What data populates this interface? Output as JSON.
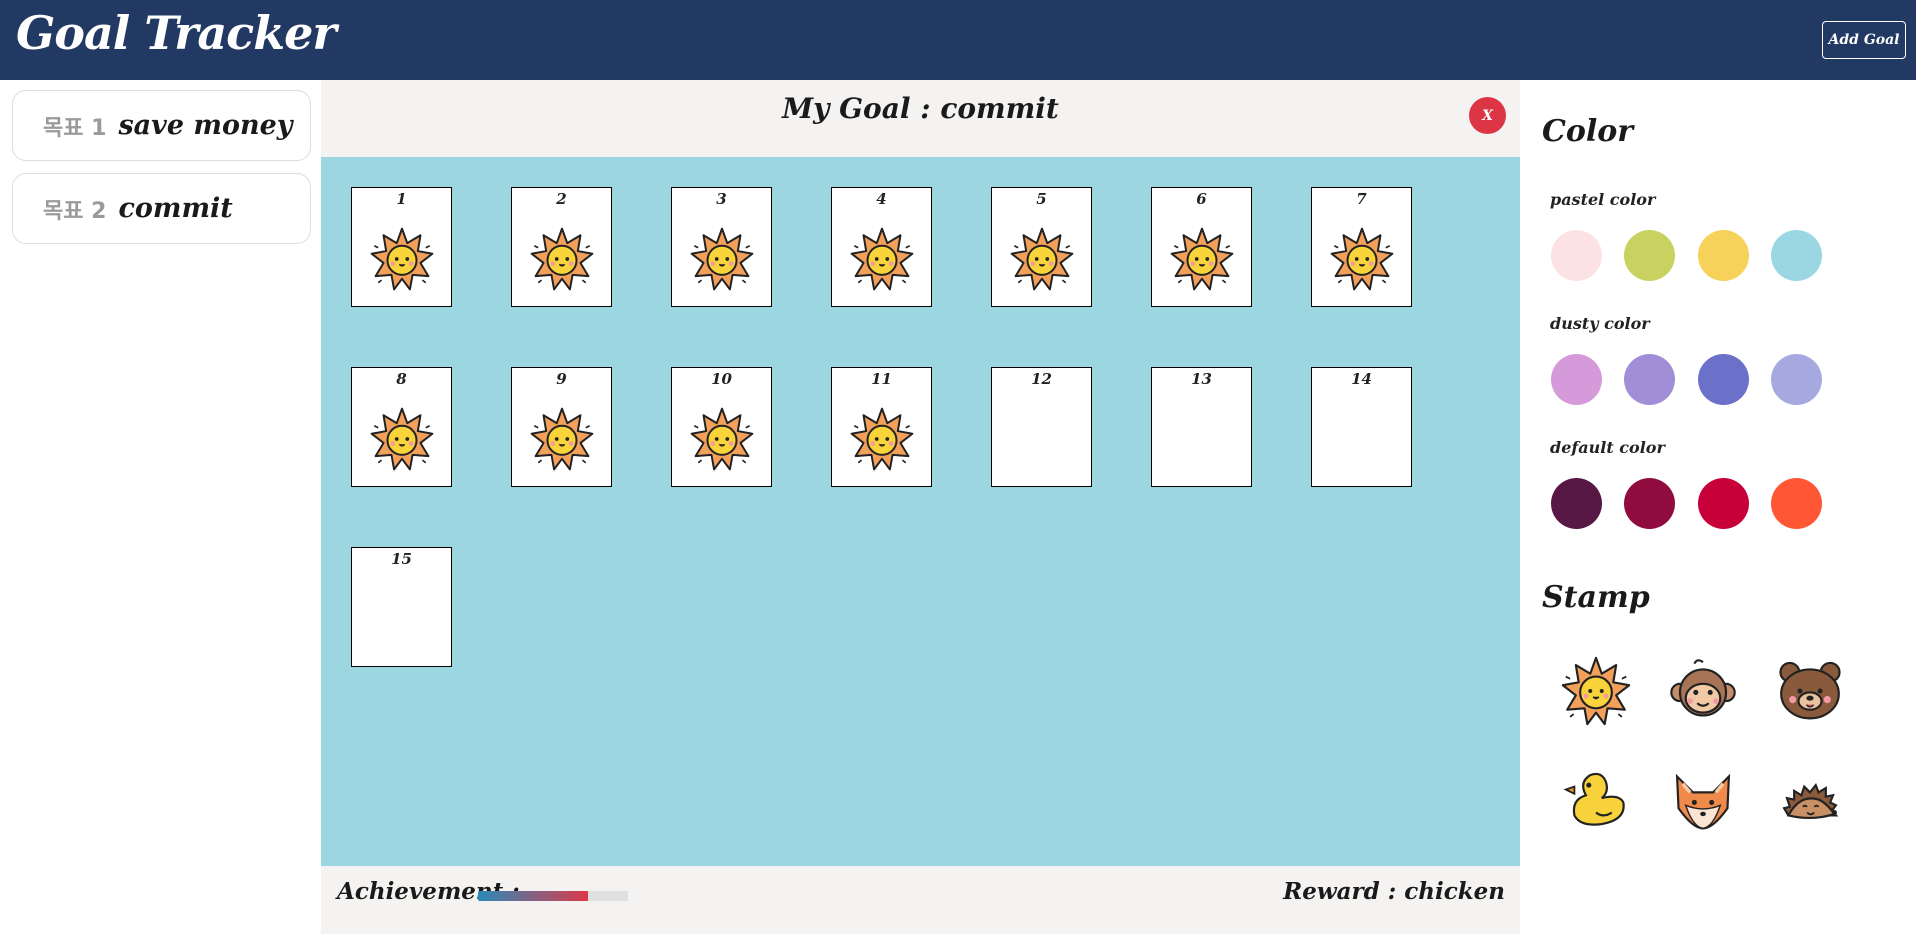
{
  "header": {
    "title": "Goal Tracker",
    "add_goal_label": "Add Goal"
  },
  "sidebar": {
    "goals": [
      {
        "index": "목표 1",
        "name": "save money"
      },
      {
        "index": "목표 2",
        "name": "commit"
      }
    ]
  },
  "main": {
    "title": "My Goal : commit",
    "close_label": "X",
    "cards": [
      {
        "num": "1",
        "stamped": true
      },
      {
        "num": "2",
        "stamped": true
      },
      {
        "num": "3",
        "stamped": true
      },
      {
        "num": "4",
        "stamped": true
      },
      {
        "num": "5",
        "stamped": true
      },
      {
        "num": "6",
        "stamped": true
      },
      {
        "num": "7",
        "stamped": true
      },
      {
        "num": "8",
        "stamped": true
      },
      {
        "num": "9",
        "stamped": true
      },
      {
        "num": "10",
        "stamped": true
      },
      {
        "num": "11",
        "stamped": true
      },
      {
        "num": "12",
        "stamped": false
      },
      {
        "num": "13",
        "stamped": false
      },
      {
        "num": "14",
        "stamped": false
      },
      {
        "num": "15",
        "stamped": false
      }
    ],
    "board_color": "#9cd6e0"
  },
  "footer": {
    "achievement_label": "Achievement :",
    "progress": 0.73,
    "reward": "Reward : chicken"
  },
  "palette": {
    "title": "Color",
    "groups": [
      {
        "label": "pastel color",
        "colors": [
          "#fde2e4",
          "#c9d260",
          "#f6d25a",
          "#9ad7e2"
        ]
      },
      {
        "label": "dusty color",
        "colors": [
          "#d59ad9",
          "#a08fd7",
          "#6b70c9",
          "#a6a9e0"
        ]
      },
      {
        "label": "default color",
        "colors": [
          "#581845",
          "#900c3f",
          "#c70039",
          "#ff5733"
        ]
      }
    ]
  },
  "stamps": {
    "title": "Stamp",
    "items": [
      "sun-icon",
      "monkey-icon",
      "bear-icon",
      "duck-icon",
      "fox-icon",
      "hedgehog-icon"
    ]
  }
}
